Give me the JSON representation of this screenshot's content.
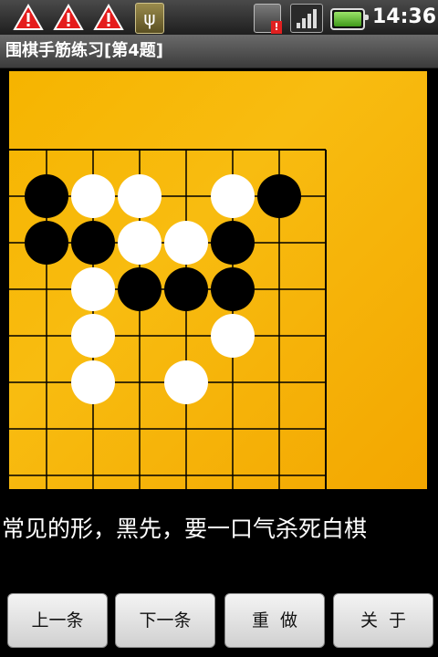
{
  "status_bar": {
    "icons": [
      "warning-icon",
      "warning-icon",
      "warning-icon",
      "usb-icon",
      "sim-alert-icon",
      "signal-icon",
      "battery-icon"
    ],
    "time": "14:36"
  },
  "app": {
    "title": "围棋手筋练习[第4题]"
  },
  "board": {
    "grid_cols": 7,
    "grid_rows": 8,
    "stones": [
      {
        "color": "black",
        "col": 1,
        "row": 1
      },
      {
        "color": "white",
        "col": 2,
        "row": 1
      },
      {
        "color": "white",
        "col": 3,
        "row": 1
      },
      {
        "color": "white",
        "col": 5,
        "row": 1
      },
      {
        "color": "black",
        "col": 6,
        "row": 1
      },
      {
        "color": "black",
        "col": 1,
        "row": 2
      },
      {
        "color": "black",
        "col": 2,
        "row": 2
      },
      {
        "color": "white",
        "col": 3,
        "row": 2
      },
      {
        "color": "white",
        "col": 4,
        "row": 2
      },
      {
        "color": "black",
        "col": 5,
        "row": 2
      },
      {
        "color": "white",
        "col": 2,
        "row": 3
      },
      {
        "color": "black",
        "col": 3,
        "row": 3
      },
      {
        "color": "black",
        "col": 4,
        "row": 3
      },
      {
        "color": "black",
        "col": 5,
        "row": 3
      },
      {
        "color": "white",
        "col": 2,
        "row": 4
      },
      {
        "color": "white",
        "col": 5,
        "row": 4
      },
      {
        "color": "white",
        "col": 2,
        "row": 5
      },
      {
        "color": "white",
        "col": 4,
        "row": 5
      }
    ],
    "colors": {
      "black_stone": "#000000",
      "white_stone": "#ffffff",
      "grid_line": "#000000",
      "board_wood": "#f6b400"
    }
  },
  "hint": "常见的形，黑先，要一口气杀死白棋",
  "buttons": {
    "prev": "上一条",
    "next": "下一条",
    "redo": "重  做",
    "about": "关  于"
  }
}
